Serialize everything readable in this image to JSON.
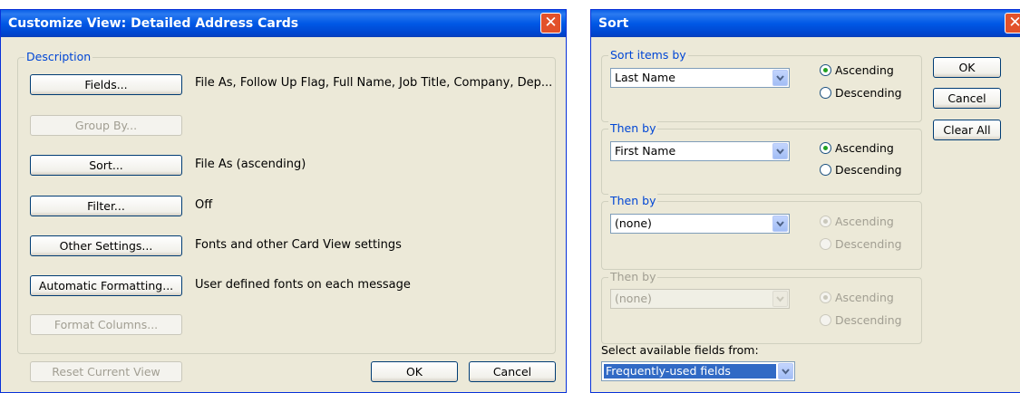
{
  "customize": {
    "title": "Customize View: Detailed Address Cards",
    "close": "✕",
    "group_label": "Description",
    "rows": [
      {
        "button": "Fields...",
        "enabled": true,
        "value": "File As, Follow Up Flag, Full Name, Job Title, Company, Dep..."
      },
      {
        "button": "Group By...",
        "enabled": false,
        "value": ""
      },
      {
        "button": "Sort...",
        "enabled": true,
        "value": "File As (ascending)"
      },
      {
        "button": "Filter...",
        "enabled": true,
        "value": "Off"
      },
      {
        "button": "Other Settings...",
        "enabled": true,
        "value": "Fonts and other Card View settings"
      },
      {
        "button": "Automatic Formatting...",
        "enabled": true,
        "value": "User defined fonts on each message"
      },
      {
        "button": "Format Columns...",
        "enabled": false,
        "value": ""
      }
    ],
    "reset_button": "Reset Current View",
    "ok_button": "OK",
    "cancel_button": "Cancel"
  },
  "sort": {
    "title": "Sort",
    "close": "✕",
    "groups": [
      {
        "label": "Sort items by",
        "field": "Last Name",
        "ascending": "Ascending",
        "descending": "Descending",
        "selected": "ascending",
        "enabled": true,
        "radios_enabled": true
      },
      {
        "label": "Then by",
        "field": "First Name",
        "ascending": "Ascending",
        "descending": "Descending",
        "selected": "ascending",
        "enabled": true,
        "radios_enabled": true
      },
      {
        "label": "Then by",
        "field": "(none)",
        "ascending": "Ascending",
        "descending": "Descending",
        "selected": "ascending",
        "enabled": true,
        "radios_enabled": false
      },
      {
        "label": "Then by",
        "field": "(none)",
        "ascending": "Ascending",
        "descending": "Descending",
        "selected": "ascending",
        "enabled": false,
        "radios_enabled": false
      }
    ],
    "ok_button": "OK",
    "cancel_button": "Cancel",
    "clear_button": "Clear All",
    "fields_label": "Select available fields from:",
    "fields_value": "Frequently-used fields"
  },
  "colors": {
    "title_bar": "#0054e3",
    "dialog_bg": "#ece9d8",
    "group_label": "#0046d5",
    "close_button": "#e2512a",
    "selection": "#316ac5"
  }
}
